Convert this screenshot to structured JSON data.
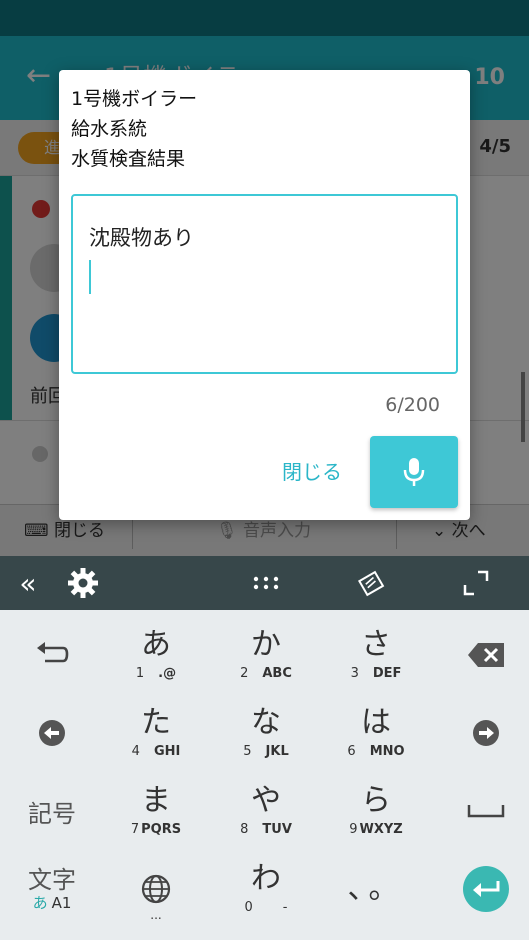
{
  "app": {
    "back_icon": "arrow-left-icon",
    "title": "1号機ボイラー",
    "count": "10",
    "progress_badge": "進",
    "page_indicator": "4/5",
    "prev_label": "前回",
    "toolbar": {
      "keyboard_close_label": "閉じる",
      "voice_input_label": "音声入力",
      "next_label": "次へ"
    }
  },
  "dialog": {
    "lines": [
      "1号機ボイラー",
      "給水系統",
      "水質検査結果"
    ],
    "text_value": "沈殿物あり",
    "counter": "6/200",
    "close_label": "閉じる",
    "mic_icon": "microphone-icon",
    "accent_color": "#3ec8d6"
  },
  "keyboard": {
    "top_bar": {
      "collapse_icon": "double-chevron-left-icon",
      "settings_icon": "gear-icon",
      "grid_icon": "dots-grid-icon",
      "handwriting_icon": "keyboard-pen-icon",
      "fullscreen_icon": "expand-icon"
    },
    "keys": {
      "a": {
        "main": "あ",
        "num": "1",
        "sub": ".@"
      },
      "ka": {
        "main": "か",
        "num": "2",
        "sub": "ABC"
      },
      "sa": {
        "main": "さ",
        "num": "3",
        "sub": "DEF"
      },
      "ta": {
        "main": "た",
        "num": "4",
        "sub": "GHI"
      },
      "na": {
        "main": "な",
        "num": "5",
        "sub": "JKL"
      },
      "ha": {
        "main": "は",
        "num": "6",
        "sub": "MNO"
      },
      "ma": {
        "main": "ま",
        "num": "7",
        "sub": "PQRS"
      },
      "ya": {
        "main": "や",
        "num": "8",
        "sub": "TUV"
      },
      "ra": {
        "main": "ら",
        "num": "9",
        "sub": "WXYZ"
      },
      "wa": {
        "main": "わ",
        "num": "0",
        "sub": "-"
      },
      "punct": "、。",
      "kigou": "記号",
      "moji": "文字",
      "moji_sub_a": "あ",
      "moji_sub_rest": "A1",
      "globe_dots": "..."
    }
  }
}
